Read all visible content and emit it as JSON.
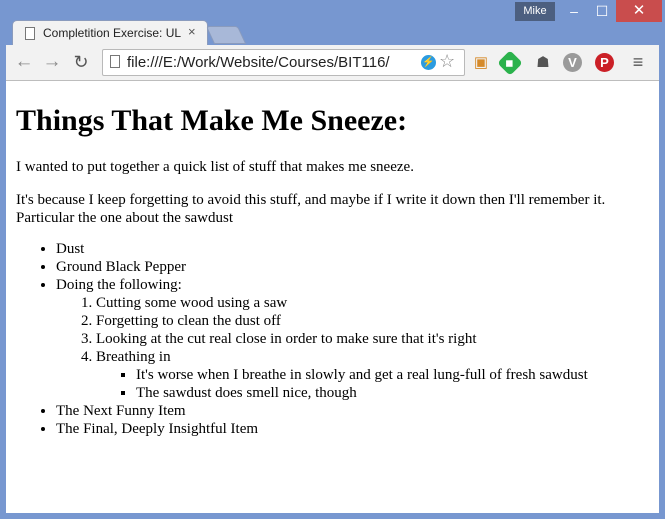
{
  "window": {
    "user": "Mike",
    "min_glyph": "–",
    "max_glyph": "☐",
    "close_glyph": "✕"
  },
  "tab": {
    "title": "Completition Exercise: UL",
    "close_glyph": "×"
  },
  "toolbar": {
    "back_glyph": "←",
    "forward_glyph": "→",
    "reload_glyph": "↻",
    "url": "file:///E:/Work/Website/Courses/BIT116/",
    "star_glyph": "☆",
    "menu_glyph": "≡"
  },
  "extensions": [
    "box-icon",
    "feedly-icon",
    "ghostery-icon",
    "vimeo-icon",
    "pinterest-icon"
  ],
  "page": {
    "heading": "Things That Make Me Sneeze:",
    "para1": "I wanted to put together a quick list of stuff that makes me sneeze.",
    "para2": "It's because I keep forgetting to avoid this stuff, and maybe if I write it down then I'll remember it.  Particular the one about the sawdust",
    "items": {
      "i1": "Dust",
      "i2": "Ground Black Pepper",
      "i3": "Doing the following:",
      "o1": "Cutting some wood using a saw",
      "o2": "Forgetting to clean the dust off",
      "o3": "Looking at the cut real close in order to make sure that it's right",
      "o4": "Breathing in",
      "s1": "It's worse when I breathe in slowly and get a real lung-full of fresh sawdust",
      "s2": "The sawdust does smell nice, though",
      "i4": "The Next Funny Item",
      "i5": "The Final, Deeply Insightful Item"
    }
  },
  "colors": {
    "frame": "#7797d0",
    "close_button": "#c94d4d",
    "user_badge": "#4c5f80"
  }
}
